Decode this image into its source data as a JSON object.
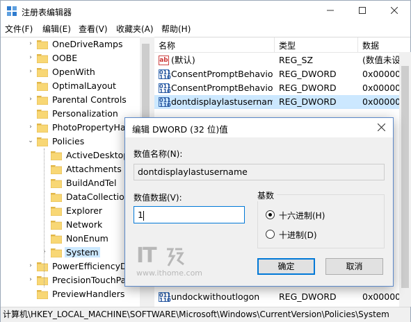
{
  "window": {
    "title": "注册表编辑器",
    "controls": [
      "minimize",
      "maximize",
      "close"
    ]
  },
  "menu": [
    "文件(F)",
    "编辑(E)",
    "查看(V)",
    "收藏夹(A)",
    "帮助(H)"
  ],
  "tree": {
    "items": [
      {
        "label": "OneDriveRamps",
        "expandable": true,
        "level": 1
      },
      {
        "label": "OOBE",
        "expandable": true,
        "level": 1
      },
      {
        "label": "OpenWith",
        "expandable": true,
        "level": 1
      },
      {
        "label": "OptimalLayout",
        "expandable": false,
        "level": 1
      },
      {
        "label": "Parental Controls",
        "expandable": true,
        "level": 1
      },
      {
        "label": "Personalization",
        "expandable": false,
        "level": 1
      },
      {
        "label": "PhotoPropertyHan",
        "expandable": true,
        "level": 1
      },
      {
        "label": "Policies",
        "expandable": true,
        "expanded": true,
        "level": 1
      },
      {
        "label": "ActiveDesktop",
        "expandable": false,
        "level": 2
      },
      {
        "label": "Attachments",
        "expandable": false,
        "level": 2
      },
      {
        "label": "BuildAndTel",
        "expandable": false,
        "level": 2
      },
      {
        "label": "DataCollection",
        "expandable": false,
        "level": 2
      },
      {
        "label": "Explorer",
        "expandable": false,
        "level": 2
      },
      {
        "label": "Network",
        "expandable": false,
        "level": 2
      },
      {
        "label": "NonEnum",
        "expandable": false,
        "level": 2
      },
      {
        "label": "System",
        "expandable": true,
        "level": 2,
        "selected": true
      },
      {
        "label": "PowerEfficiencyDia",
        "expandable": true,
        "level": 1
      },
      {
        "label": "PrecisionTouchPac",
        "expandable": true,
        "level": 1
      },
      {
        "label": "PreviewHandlers",
        "expandable": false,
        "level": 1
      }
    ]
  },
  "list": {
    "columns": [
      "名称",
      "类型",
      "数据"
    ],
    "rows": [
      {
        "icon": "ab",
        "name": "(默认)",
        "type": "REG_SZ",
        "data": "(数值未设"
      },
      {
        "icon": "dword",
        "name": "ConsentPromptBehavio...",
        "type": "REG_DWORD",
        "data": "0x000000"
      },
      {
        "icon": "dword",
        "name": "ConsentPromptBehavio...",
        "type": "REG_DWORD",
        "data": "0x000000"
      },
      {
        "icon": "dword",
        "name": "dontdisplaylastusername",
        "type": "REG_DWORD",
        "data": "0x000000",
        "selected": true
      },
      {
        "icon": "dword",
        "name": "undockwithoutlogon",
        "type": "REG_DWORD",
        "data": "0x000000"
      }
    ]
  },
  "statusbar": "计算机\\HKEY_LOCAL_MACHINE\\SOFTWARE\\Microsoft\\Windows\\CurrentVersion\\Policies\\System",
  "dialog": {
    "title": "编辑 DWORD (32 位)值",
    "name_label": "数值名称(N):",
    "name_value": "dontdisplaylastusername",
    "data_label": "数值数据(V):",
    "data_value": "1",
    "radix_label": "基数",
    "radix_options": [
      "十六进制(H)",
      "十进制(D)"
    ],
    "radix_selected": "十六进制(H)",
    "ok_label": "确定",
    "cancel_label": "取消"
  },
  "watermark": {
    "logo": "IT之家",
    "url": "www.ithome.com"
  },
  "colors": {
    "selection": "#cce8ff",
    "accent": "#0078d7",
    "folder": "#f8d775"
  }
}
